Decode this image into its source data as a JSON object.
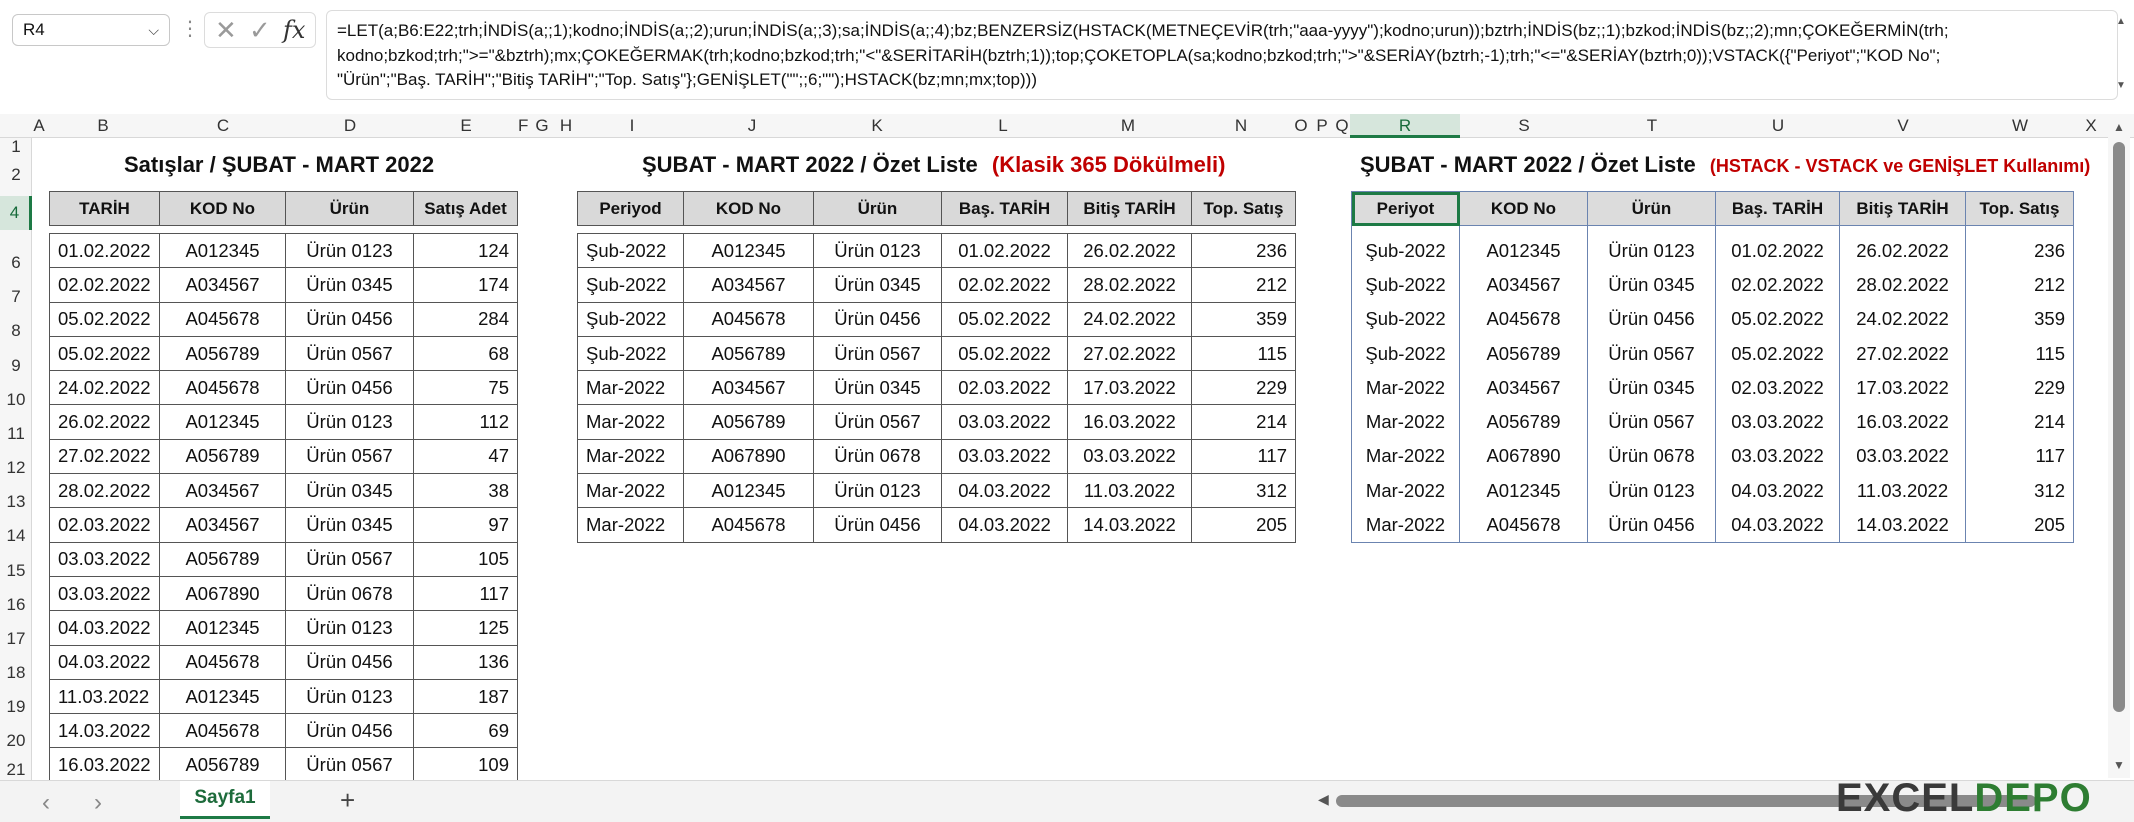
{
  "namebox": "R4",
  "formula": "=LET(a;B6:E22;trh;İNDİS(a;;1);kodno;İNDİS(a;;2);urun;İNDİS(a;;3);sa;İNDİS(a;;4);bz;BENZERSİZ(HSTACK(METNEÇEVİR(trh;\"aaa-yyyy\");kodno;urun));bztrh;İNDİS(bz;;1);bzkod;İNDİS(bz;;2);mn;ÇOKEĞERMİN(trh;\nkodno;bzkod;trh;\">=\"&bztrh);mx;ÇOKEĞERMAK(trh;kodno;bzkod;trh;\"<\"&SERİTARİH(bztrh;1));top;ÇOKETOPLA(sa;kodno;bzkod;trh;\">\"&SERİAY(bztrh;-1);trh;\"<=\"&SERİAY(bztrh;0));VSTACK({\"Periyot\";\"KOD No\";\n\"Ürün\";\"Baş. TARİH\";\"Bitiş TARİH\";\"Top. Satış\"};GENİŞLET(\"\";;6;\"\");HSTACK(bz;mn;mx;top)))",
  "columns": [
    "A",
    "B",
    "C",
    "D",
    "E",
    "F",
    "G",
    "H",
    "I",
    "J",
    "K",
    "L",
    "M",
    "N",
    "O",
    "P",
    "Q",
    "R",
    "S",
    "T",
    "U",
    "V",
    "W",
    "X"
  ],
  "rows": [
    "1",
    "2",
    "4",
    "6",
    "7",
    "8",
    "9",
    "10",
    "11",
    "12",
    "13",
    "14",
    "15",
    "16",
    "17",
    "18",
    "19",
    "20",
    "21"
  ],
  "selected_column": "R",
  "selected_row": "4",
  "title1": "Satışlar / ŞUBAT - MART  2022",
  "title2": "ŞUBAT - MART 2022 / Özet Liste",
  "title2_red": "(Klasik 365 Dökülmeli)",
  "title3": "ŞUBAT - MART 2022 / Özet Liste",
  "title3_red": "(HSTACK - VSTACK ve GENİŞLET Kullanımı)",
  "sales": {
    "headers": [
      "TARİH",
      "KOD No",
      "Ürün",
      "Satış Adet"
    ],
    "rows": [
      [
        "01.02.2022",
        "A012345",
        "Ürün 0123",
        "124"
      ],
      [
        "02.02.2022",
        "A034567",
        "Ürün 0345",
        "174"
      ],
      [
        "05.02.2022",
        "A045678",
        "Ürün 0456",
        "284"
      ],
      [
        "05.02.2022",
        "A056789",
        "Ürün 0567",
        "68"
      ],
      [
        "24.02.2022",
        "A045678",
        "Ürün 0456",
        "75"
      ],
      [
        "26.02.2022",
        "A012345",
        "Ürün 0123",
        "112"
      ],
      [
        "27.02.2022",
        "A056789",
        "Ürün 0567",
        "47"
      ],
      [
        "28.02.2022",
        "A034567",
        "Ürün 0345",
        "38"
      ],
      [
        "02.03.2022",
        "A034567",
        "Ürün 0345",
        "97"
      ],
      [
        "03.03.2022",
        "A056789",
        "Ürün 0567",
        "105"
      ],
      [
        "03.03.2022",
        "A067890",
        "Ürün 0678",
        "117"
      ],
      [
        "04.03.2022",
        "A012345",
        "Ürün 0123",
        "125"
      ],
      [
        "04.03.2022",
        "A045678",
        "Ürün 0456",
        "136"
      ],
      [
        "11.03.2022",
        "A012345",
        "Ürün 0123",
        "187"
      ],
      [
        "14.03.2022",
        "A045678",
        "Ürün 0456",
        "69"
      ],
      [
        "16.03.2022",
        "A056789",
        "Ürün 0567",
        "109"
      ]
    ]
  },
  "summary_classic": {
    "headers": [
      "Periyod",
      "KOD No",
      "Ürün",
      "Baş. TARİH",
      "Bitiş TARİH",
      "Top. Satış"
    ],
    "rows": [
      [
        "Şub-2022",
        "A012345",
        "Ürün 0123",
        "01.02.2022",
        "26.02.2022",
        "236"
      ],
      [
        "Şub-2022",
        "A034567",
        "Ürün 0345",
        "02.02.2022",
        "28.02.2022",
        "212"
      ],
      [
        "Şub-2022",
        "A045678",
        "Ürün 0456",
        "05.02.2022",
        "24.02.2022",
        "359"
      ],
      [
        "Şub-2022",
        "A056789",
        "Ürün 0567",
        "05.02.2022",
        "27.02.2022",
        "115"
      ],
      [
        "Mar-2022",
        "A034567",
        "Ürün 0345",
        "02.03.2022",
        "17.03.2022",
        "229"
      ],
      [
        "Mar-2022",
        "A056789",
        "Ürün 0567",
        "03.03.2022",
        "16.03.2022",
        "214"
      ],
      [
        "Mar-2022",
        "A067890",
        "Ürün 0678",
        "03.03.2022",
        "03.03.2022",
        "117"
      ],
      [
        "Mar-2022",
        "A012345",
        "Ürün 0123",
        "04.03.2022",
        "11.03.2022",
        "312"
      ],
      [
        "Mar-2022",
        "A045678",
        "Ürün 0456",
        "04.03.2022",
        "14.03.2022",
        "205"
      ]
    ]
  },
  "summary_stack": {
    "headers": [
      "Periyot",
      "KOD No",
      "Ürün",
      "Baş. TARİH",
      "Bitiş TARİH",
      "Top. Satış"
    ],
    "rows": [
      [
        "Şub-2022",
        "A012345",
        "Ürün 0123",
        "01.02.2022",
        "26.02.2022",
        "236"
      ],
      [
        "Şub-2022",
        "A034567",
        "Ürün 0345",
        "02.02.2022",
        "28.02.2022",
        "212"
      ],
      [
        "Şub-2022",
        "A045678",
        "Ürün 0456",
        "05.02.2022",
        "24.02.2022",
        "359"
      ],
      [
        "Şub-2022",
        "A056789",
        "Ürün 0567",
        "05.02.2022",
        "27.02.2022",
        "115"
      ],
      [
        "Mar-2022",
        "A034567",
        "Ürün 0345",
        "02.03.2022",
        "17.03.2022",
        "229"
      ],
      [
        "Mar-2022",
        "A056789",
        "Ürün 0567",
        "03.03.2022",
        "16.03.2022",
        "214"
      ],
      [
        "Mar-2022",
        "A067890",
        "Ürün 0678",
        "03.03.2022",
        "03.03.2022",
        "117"
      ],
      [
        "Mar-2022",
        "A012345",
        "Ürün 0123",
        "04.03.2022",
        "11.03.2022",
        "312"
      ],
      [
        "Mar-2022",
        "A045678",
        "Ürün 0456",
        "04.03.2022",
        "14.03.2022",
        "205"
      ]
    ]
  },
  "sheet_tab": "Sayfa1",
  "add_sheet": "+",
  "watermark_a": "EXCEL",
  "watermark_b": "DEPO",
  "icons": {
    "cancel": "✕",
    "enter": "✓",
    "fx": "fx",
    "chevron": "⌵",
    "more": "⋮",
    "prev": "‹",
    "next": "›"
  }
}
